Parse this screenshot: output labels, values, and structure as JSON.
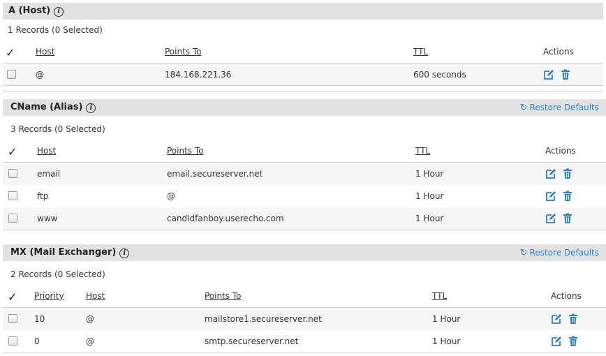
{
  "sections": {
    "a": {
      "title": "A (Host)",
      "records": "1 Records (0 Selected)",
      "columns": {
        "host": "Host",
        "points_to": "Points To",
        "ttl": "TTL",
        "actions": "Actions"
      },
      "rows": [
        {
          "host": "@",
          "points_to": "184.168.221.36",
          "ttl": "600 seconds"
        }
      ]
    },
    "cname": {
      "title": "CName (Alias)",
      "restore": "Restore Defaults",
      "records": "3 Records (0 Selected)",
      "columns": {
        "host": "Host",
        "points_to": "Points To",
        "ttl": "TTL",
        "actions": "Actions"
      },
      "rows": [
        {
          "host": "email",
          "points_to": "email.secureserver.net",
          "ttl": "1 Hour"
        },
        {
          "host": "ftp",
          "points_to": "@",
          "ttl": "1 Hour"
        },
        {
          "host": "www",
          "points_to": "candidfanboy.userecho.com",
          "ttl": "1 Hour"
        }
      ]
    },
    "mx": {
      "title": "MX (Mail Exchanger)",
      "restore": "Restore Defaults",
      "records": "2 Records (0 Selected)",
      "columns": {
        "priority": "Priority",
        "host": "Host",
        "points_to": "Points To",
        "ttl": "TTL",
        "actions": "Actions"
      },
      "rows": [
        {
          "priority": "10",
          "host": "@",
          "points_to": "mailstore1.secureserver.net",
          "ttl": "1 Hour"
        },
        {
          "priority": "0",
          "host": "@",
          "points_to": "smtp.secureserver.net",
          "ttl": "1 Hour"
        }
      ]
    }
  },
  "icons": {
    "info": "info-icon",
    "edit": "edit-icon",
    "delete": "trash-icon",
    "restore": "refresh-icon",
    "check": "checkmark-icon"
  },
  "colors": {
    "accent": "#2f7fc5",
    "header_bg": "#e2e2e2"
  }
}
